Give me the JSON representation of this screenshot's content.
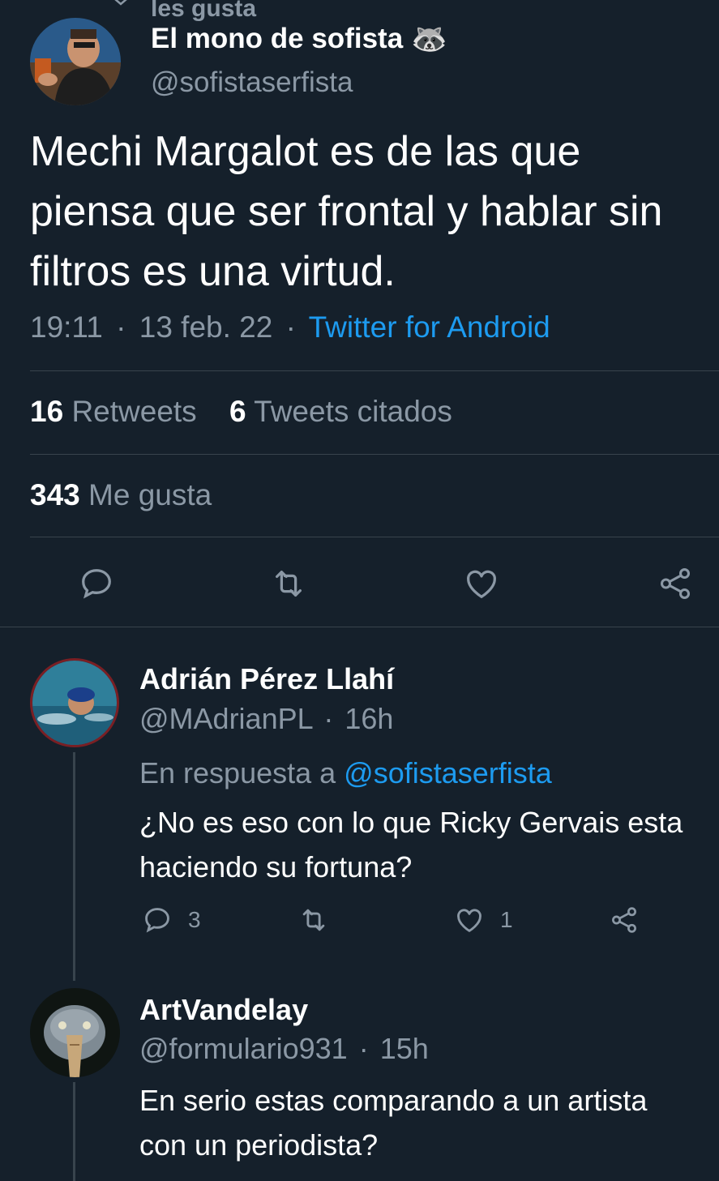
{
  "top_context": {
    "text": "les gusta"
  },
  "tweet": {
    "author_name": "El mono de sofista",
    "author_emoji": "🦝",
    "handle": "@sofistaserfista",
    "text_lines": [
      "Mechi Margalot es de las que",
      "piensa que ser frontal y hablar sin",
      "filtros es una virtud."
    ],
    "time": "19:11",
    "date": "13 feb. 22",
    "separator": "·",
    "source": "Twitter for Android",
    "retweets_count": "16",
    "retweets_label": "Retweets",
    "quotes_count": "6",
    "quotes_label": "Tweets citados",
    "likes_count": "343",
    "likes_label": "Me gusta"
  },
  "actions": {
    "reply_icon": "reply-icon",
    "retweet_icon": "retweet-icon",
    "like_icon": "heart-icon",
    "share_icon": "share-icon"
  },
  "replies": [
    {
      "name": "Adrián Pérez Llahí",
      "handle": "@MAdrianPL",
      "separator": "·",
      "time": "16h",
      "reply_to_label": "En respuesta a",
      "reply_to_handle": "@sofistaserfista",
      "text_lines": [
        "¿No es eso con lo que Ricky Gervais esta",
        "haciendo su fortuna?"
      ],
      "reply_count": "3",
      "like_count": "1"
    },
    {
      "name": "ArtVandelay",
      "handle": "@formulario931",
      "separator": "·",
      "time": "15h",
      "text_lines": [
        "En serio estas comparando a un artista",
        "con un periodista?"
      ]
    }
  ],
  "colors": {
    "background": "#15202b",
    "text": "#ffffff",
    "muted": "#8b98a5",
    "link": "#1d9bf0",
    "divider": "#38444d"
  }
}
